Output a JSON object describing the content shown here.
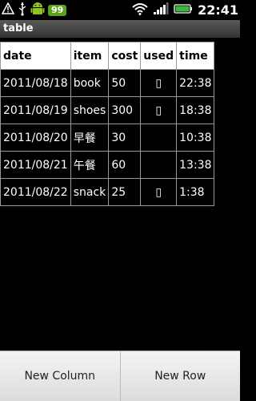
{
  "status_bar": {
    "battery_badge": "99",
    "clock": "22:41",
    "icons": [
      "warning-icon",
      "usb-icon",
      "android-icon",
      "wifi-icon",
      "signal-icon",
      "battery-icon"
    ]
  },
  "title": "table",
  "table": {
    "headers": [
      "date",
      "item",
      "cost",
      "used",
      "time"
    ],
    "rows": [
      [
        "2011/08/18",
        "book",
        "50",
        "▯",
        "22:38"
      ],
      [
        "2011/08/19",
        "shoes",
        "300",
        "▯",
        "18:38"
      ],
      [
        "2011/08/20",
        "早餐",
        "30",
        "",
        "10:38"
      ],
      [
        "2011/08/21",
        "午餐",
        "60",
        "",
        "13:38"
      ],
      [
        "2011/08/22",
        "snack",
        "25",
        "▯",
        "1:38"
      ]
    ]
  },
  "buttons": {
    "new_column": "New Column",
    "new_row": "New Row"
  }
}
